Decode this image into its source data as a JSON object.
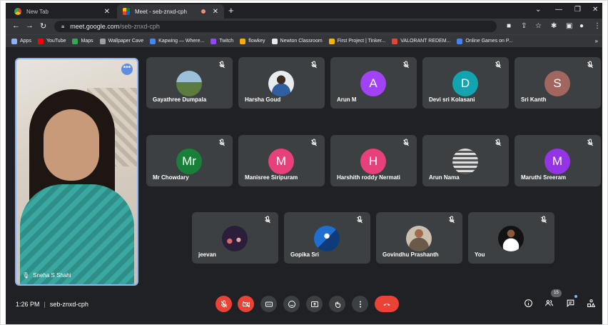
{
  "browser": {
    "tabs": [
      {
        "title": "New Tab",
        "active": false
      },
      {
        "title": "Meet - seb-znxd-cph",
        "active": true
      }
    ],
    "url_host": "meet.google.com",
    "url_path": "/seb-znxd-cph",
    "bookmarks": [
      {
        "label": "Apps",
        "color": "#8ab4f8"
      },
      {
        "label": "YouTube",
        "color": "#ff0000"
      },
      {
        "label": "Maps",
        "color": "#34a853"
      },
      {
        "label": "Wallpaper Cave",
        "color": "#9aa0a6"
      },
      {
        "label": "Kapwing — Where...",
        "color": "#4285f4"
      },
      {
        "label": "Twitch",
        "color": "#9146ff"
      },
      {
        "label": "flowkey",
        "color": "#f9ab00"
      },
      {
        "label": "Newton Classroom",
        "color": "#e8eaed"
      },
      {
        "label": "First Project | Tinker...",
        "color": "#f4b400"
      },
      {
        "label": "VALORANT REDEM...",
        "color": "#ea4335"
      },
      {
        "label": "Online Games on P...",
        "color": "#4285f4"
      }
    ]
  },
  "meet": {
    "self_name": "Sneha S Shahi",
    "time": "1:26 PM",
    "meeting_code": "seb-znxd-cph",
    "participant_count": "15",
    "participants": [
      {
        "name": "Gayathree Dumpala",
        "initial": "",
        "color": "",
        "photo": "ph-landscape"
      },
      {
        "name": "Harsha Goud",
        "initial": "",
        "color": "",
        "photo": "ph-person"
      },
      {
        "name": "Arun M",
        "initial": "A",
        "color": "#a142f4",
        "photo": ""
      },
      {
        "name": "Devi sri Kolasani",
        "initial": "D",
        "color": "#12a4af",
        "photo": ""
      },
      {
        "name": "Sri Kanth",
        "initial": "S",
        "color": "#a1665e",
        "photo": ""
      },
      {
        "name": "Mr Chowdary",
        "initial": "Mr",
        "color": "#188038",
        "photo": ""
      },
      {
        "name": "Manisree Siripuram",
        "initial": "M",
        "color": "#e8407a",
        "photo": ""
      },
      {
        "name": "Harshith roddy Nermati",
        "initial": "H",
        "color": "#e8407a",
        "photo": ""
      },
      {
        "name": "Arun Nama",
        "initial": "",
        "color": "",
        "photo": "ph-stripes"
      },
      {
        "name": "Maruthi Sreeram",
        "initial": "M",
        "color": "#9334e6",
        "photo": ""
      },
      {
        "name": "jeevan",
        "initial": "",
        "color": "",
        "photo": "ph-dark"
      },
      {
        "name": "Gopika Sri",
        "initial": "",
        "color": "",
        "photo": "ph-blue"
      },
      {
        "name": "Govindhu Prashanth",
        "initial": "",
        "color": "",
        "photo": "ph-man"
      },
      {
        "name": "You",
        "initial": "",
        "color": "",
        "photo": "ph-you"
      }
    ]
  }
}
